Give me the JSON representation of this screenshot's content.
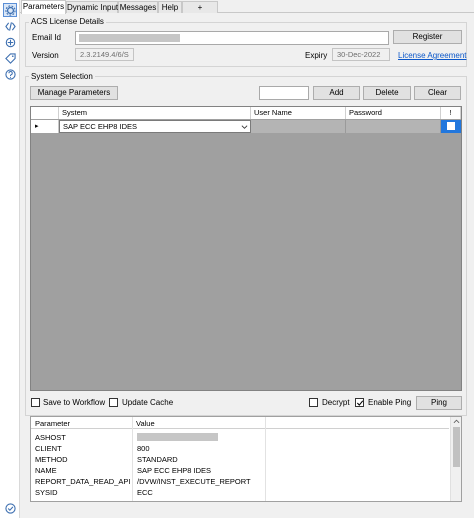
{
  "tabs": [
    "Parameters",
    "Dynamic Input",
    "Messages",
    "Help",
    "+"
  ],
  "acs": {
    "title": "ACS License Details",
    "email_label": "Email Id",
    "register_label": "Register",
    "version_label": "Version",
    "version_value": "2.3.2149.4/6/S",
    "expiry_label": "Expiry",
    "expiry_value": "30-Dec-2022",
    "license_link": "License Agreement"
  },
  "system_selection": {
    "title": "System Selection",
    "manage_label": "Manage Parameters",
    "add_label": "Add",
    "delete_label": "Delete",
    "clear_label": "Clear",
    "grid_headers": [
      "System",
      "User Name",
      "Password",
      "!"
    ],
    "rows": [
      {
        "marker": "▸",
        "system": "SAP ECC EHP8 IDES",
        "checked": true
      }
    ]
  },
  "options": {
    "save_to_workflow": "Save to Workflow",
    "update_cache": "Update Cache",
    "decrypt": "Decrypt",
    "enable_ping": "Enable Ping",
    "enable_ping_checked": true,
    "ping_label": "Ping"
  },
  "params_table": {
    "headers": [
      "Parameter",
      "Value"
    ],
    "rows": [
      {
        "name": "ASHOST",
        "value": ""
      },
      {
        "name": "CLIENT",
        "value": "800"
      },
      {
        "name": "METHOD",
        "value": "STANDARD"
      },
      {
        "name": "NAME",
        "value": "SAP ECC EHP8 IDES"
      },
      {
        "name": "REPORT_DATA_READ_API",
        "value": "/DVW/INST_EXECUTE_REPORT"
      },
      {
        "name": "SYSID",
        "value": "ECC"
      }
    ]
  },
  "icons": [
    "settings-icon",
    "code-icon",
    "connector-icon",
    "tag-icon",
    "help-icon",
    "status-check-icon"
  ],
  "colors": {
    "accent": "#0b57c9",
    "grid_bg": "#a0a0a0",
    "selection": "#2277dd",
    "icon": "#3d6fb0"
  }
}
